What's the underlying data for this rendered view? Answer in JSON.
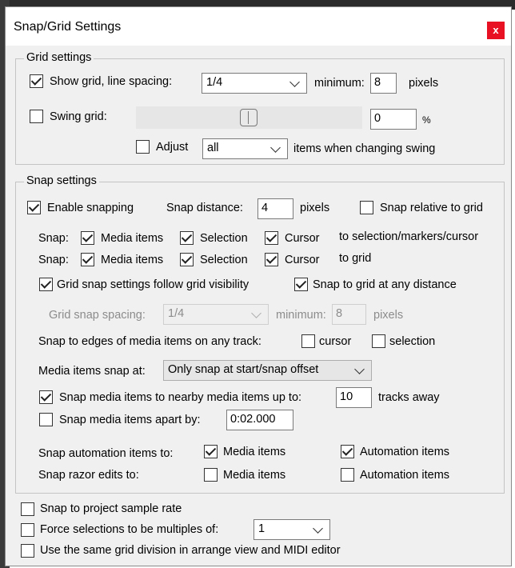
{
  "window": {
    "title": "Snap/Grid Settings",
    "close": "x"
  },
  "grid": {
    "legend": "Grid settings",
    "show_grid_label": "Show grid, line spacing:",
    "show_grid_checked": true,
    "line_spacing": "1/4",
    "minimum_label": "minimum:",
    "minimum_value": "8",
    "pixels_label": "pixels",
    "swing_label": "Swing grid:",
    "swing_checked": false,
    "swing_value": "0",
    "percent_label": "%",
    "adjust_label": "Adjust",
    "adjust_checked": false,
    "adjust_option": "all",
    "adjust_suffix": "items when changing swing"
  },
  "snap": {
    "legend": "Snap settings",
    "enable_label": "Enable snapping",
    "enable_checked": true,
    "distance_label": "Snap distance:",
    "distance_value": "4",
    "pixels_label": "pixels",
    "relative_label": "Snap relative to grid",
    "relative_checked": false,
    "rows": [
      {
        "prefix": "Snap:",
        "media": "Media items",
        "selection": "Selection",
        "cursor": "Cursor",
        "suffix": "to selection/markers/cursor"
      },
      {
        "prefix": "Snap:",
        "media": "Media items",
        "selection": "Selection",
        "cursor": "Cursor",
        "suffix": "to grid"
      }
    ],
    "follow_label": "Grid snap settings follow grid visibility",
    "any_distance_label": "Snap to grid at any distance",
    "spacing_label": "Grid snap spacing:",
    "spacing_value": "1/4",
    "spacing_min_label": "minimum:",
    "spacing_min_value": "8",
    "spacing_pixels": "pixels",
    "edges_label": "Snap to edges of media items on any track:",
    "edges_cursor": "cursor",
    "edges_selection": "selection",
    "snap_at_label": "Media items snap at:",
    "snap_at_value": "Only snap at start/snap offset",
    "nearby_label": "Snap media items to nearby media items up to:",
    "nearby_value": "10",
    "tracks_away": "tracks away",
    "apart_label": "Snap media items apart by:",
    "apart_value": "0:02.000",
    "automation_label": "Snap automation items to:",
    "auto_media": "Media items",
    "auto_automation": "Automation items",
    "razor_label": "Snap razor edits to:",
    "razor_media": "Media items",
    "razor_automation": "Automation items"
  },
  "bottom": {
    "sample_rate_label": "Snap to project sample rate",
    "multiples_label": "Force selections to be multiples of:",
    "multiples_value": "1",
    "same_grid_label": "Use the same grid division in arrange view and MIDI editor"
  }
}
